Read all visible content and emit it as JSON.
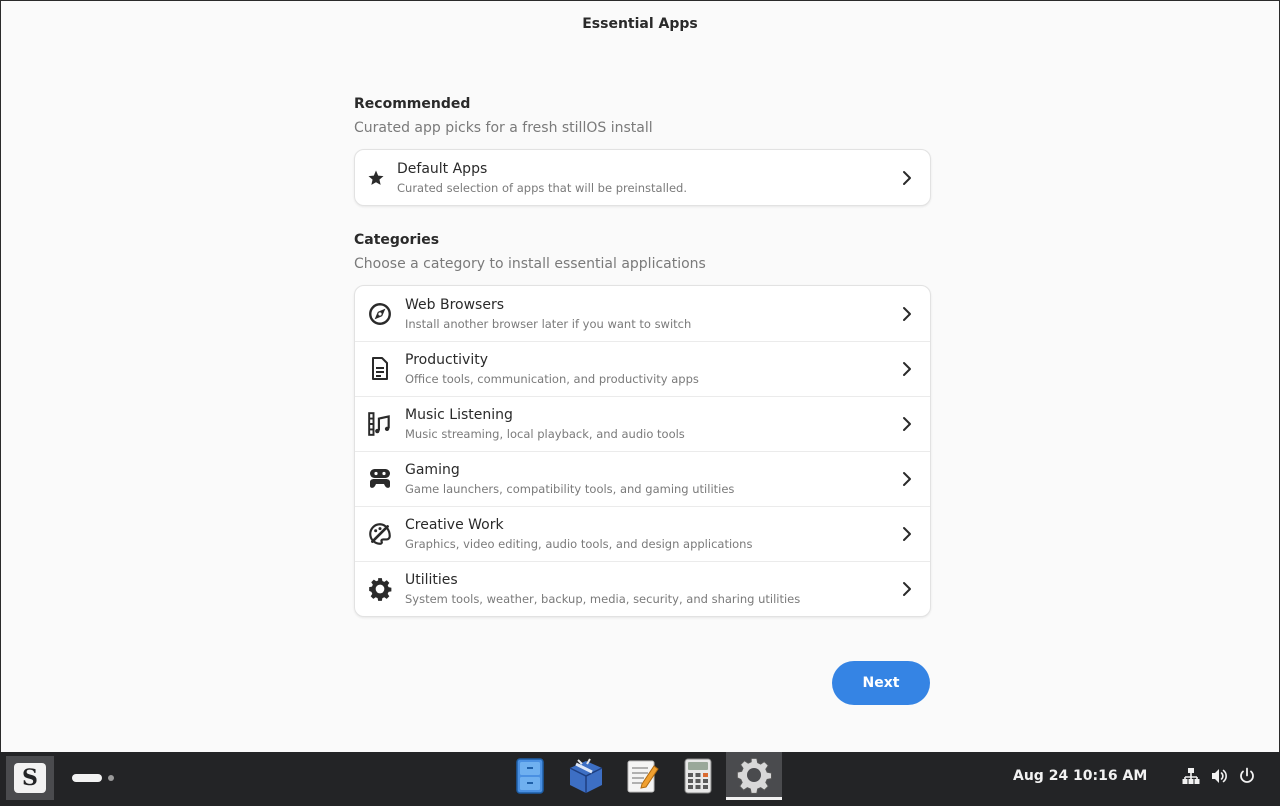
{
  "window": {
    "title": "Essential Apps"
  },
  "recommended": {
    "title": "Recommended",
    "subtitle": "Curated app picks for a fresh stillOS install",
    "items": [
      {
        "icon": "star-icon",
        "label": "Default Apps",
        "desc": "Curated selection of apps that will be preinstalled."
      }
    ]
  },
  "categories": {
    "title": "Categories",
    "subtitle": "Choose a category to install essential applications",
    "items": [
      {
        "icon": "compass-icon",
        "label": "Web Browsers",
        "desc": "Install another browser later if you want to switch"
      },
      {
        "icon": "document-icon",
        "label": "Productivity",
        "desc": "Office tools, communication, and productivity apps"
      },
      {
        "icon": "music-film-icon",
        "label": "Music Listening",
        "desc": "Music streaming, local playback, and audio tools"
      },
      {
        "icon": "gamepad-icon",
        "label": "Gaming",
        "desc": "Game launchers, compatibility tools, and gaming utilities"
      },
      {
        "icon": "palette-icon",
        "label": "Creative Work",
        "desc": "Graphics, video editing, audio tools, and design applications"
      },
      {
        "icon": "gear-icon",
        "label": "Utilities",
        "desc": "System tools, weather, backup, media, security, and sharing utilities"
      }
    ]
  },
  "actions": {
    "next_label": "Next"
  },
  "taskbar": {
    "start_logo": "S",
    "dock": [
      "file-cabinet-icon",
      "package-box-icon",
      "text-editor-icon",
      "calculator-icon",
      "settings-gear-icon"
    ],
    "clock": "Aug 24  10:16 AM",
    "tray": [
      "network-icon",
      "volume-icon",
      "power-icon"
    ]
  },
  "colors": {
    "accent": "#3584e4",
    "taskbar": "#232426"
  }
}
